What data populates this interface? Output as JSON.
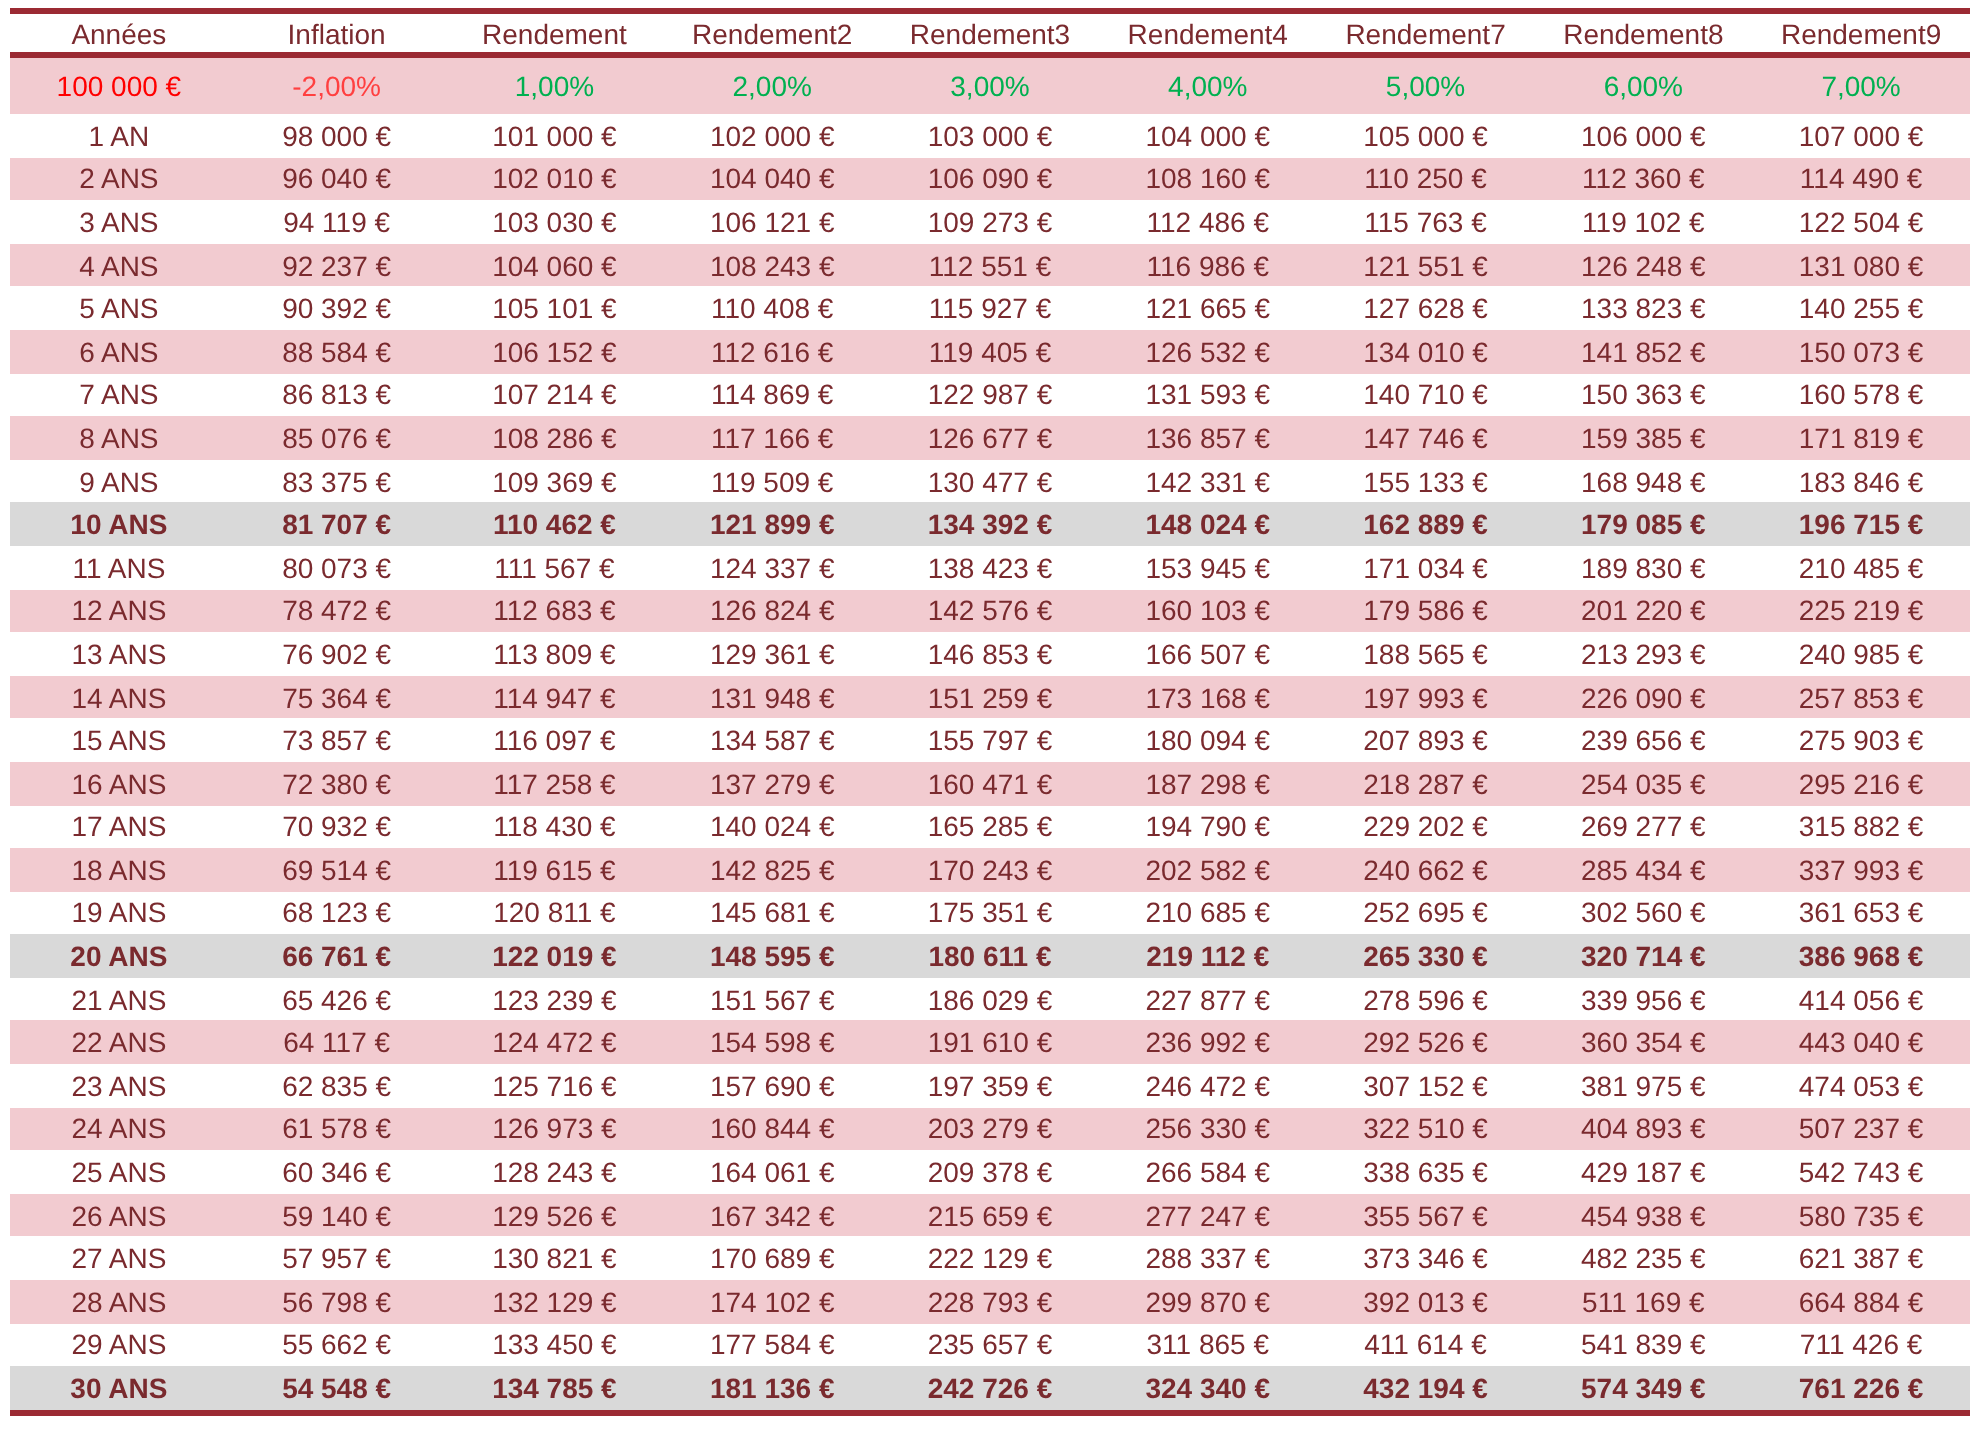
{
  "table": {
    "columns": [
      "Années",
      "Inflation",
      "Rendement",
      "Rendement2",
      "Rendement3",
      "Rendement4",
      "Rendement7",
      "Rendement8",
      "Rendement9"
    ],
    "rates": [
      {
        "text": "100 000 €",
        "color": "#ff0000"
      },
      {
        "text": "-2,00%",
        "color": "#ff4040"
      },
      {
        "text": "1,00%",
        "color": "#00b050"
      },
      {
        "text": "2,00%",
        "color": "#00b050"
      },
      {
        "text": "3,00%",
        "color": "#00b050"
      },
      {
        "text": "4,00%",
        "color": "#00b050"
      },
      {
        "text": "5,00%",
        "color": "#00b050"
      },
      {
        "text": "6,00%",
        "color": "#00b050"
      },
      {
        "text": "7,00%",
        "color": "#00b050"
      }
    ],
    "rows": [
      {
        "kind": "plain",
        "cells": [
          "1 AN",
          "98 000 €",
          "101 000 €",
          "102 000 €",
          "103 000 €",
          "104 000 €",
          "105 000 €",
          "106 000 €",
          "107 000 €"
        ]
      },
      {
        "kind": "striped",
        "cells": [
          "2 ANS",
          "96 040 €",
          "102 010 €",
          "104 040 €",
          "106 090 €",
          "108 160 €",
          "110 250 €",
          "112 360 €",
          "114 490 €"
        ]
      },
      {
        "kind": "plain",
        "cells": [
          "3 ANS",
          "94 119 €",
          "103 030 €",
          "106 121 €",
          "109 273 €",
          "112 486 €",
          "115 763 €",
          "119 102 €",
          "122 504 €"
        ]
      },
      {
        "kind": "striped",
        "cells": [
          "4 ANS",
          "92 237 €",
          "104 060 €",
          "108 243 €",
          "112 551 €",
          "116 986 €",
          "121 551 €",
          "126 248 €",
          "131 080 €"
        ]
      },
      {
        "kind": "plain",
        "cells": [
          "5 ANS",
          "90 392 €",
          "105 101 €",
          "110 408 €",
          "115 927 €",
          "121 665 €",
          "127 628 €",
          "133 823 €",
          "140 255 €"
        ]
      },
      {
        "kind": "striped",
        "cells": [
          "6 ANS",
          "88 584 €",
          "106 152 €",
          "112 616 €",
          "119 405 €",
          "126 532 €",
          "134 010 €",
          "141 852 €",
          "150 073 €"
        ]
      },
      {
        "kind": "plain",
        "cells": [
          "7 ANS",
          "86 813 €",
          "107 214 €",
          "114 869 €",
          "122 987 €",
          "131 593 €",
          "140 710 €",
          "150 363 €",
          "160 578 €"
        ]
      },
      {
        "kind": "striped",
        "cells": [
          "8 ANS",
          "85 076 €",
          "108 286 €",
          "117 166 €",
          "126 677 €",
          "136 857 €",
          "147 746 €",
          "159 385 €",
          "171 819 €"
        ]
      },
      {
        "kind": "plain",
        "cells": [
          "9 ANS",
          "83 375 €",
          "109 369 €",
          "119 509 €",
          "130 477 €",
          "142 331 €",
          "155 133 €",
          "168 948 €",
          "183 846 €"
        ]
      },
      {
        "kind": "milestone",
        "cells": [
          "10 ANS",
          "81 707 €",
          "110 462 €",
          "121 899 €",
          "134 392 €",
          "148 024 €",
          "162 889 €",
          "179 085 €",
          "196 715 €"
        ]
      },
      {
        "kind": "plain",
        "cells": [
          "11 ANS",
          "80 073 €",
          "111 567 €",
          "124 337 €",
          "138 423 €",
          "153 945 €",
          "171 034 €",
          "189 830 €",
          "210 485 €"
        ]
      },
      {
        "kind": "striped",
        "cells": [
          "12 ANS",
          "78 472 €",
          "112 683 €",
          "126 824 €",
          "142 576 €",
          "160 103 €",
          "179 586 €",
          "201 220 €",
          "225 219 €"
        ]
      },
      {
        "kind": "plain",
        "cells": [
          "13 ANS",
          "76 902 €",
          "113 809 €",
          "129 361 €",
          "146 853 €",
          "166 507 €",
          "188 565 €",
          "213 293 €",
          "240 985 €"
        ]
      },
      {
        "kind": "striped",
        "cells": [
          "14 ANS",
          "75 364 €",
          "114 947 €",
          "131 948 €",
          "151 259 €",
          "173 168 €",
          "197 993 €",
          "226 090 €",
          "257 853 €"
        ]
      },
      {
        "kind": "plain",
        "cells": [
          "15 ANS",
          "73 857 €",
          "116 097 €",
          "134 587 €",
          "155 797 €",
          "180 094 €",
          "207 893 €",
          "239 656 €",
          "275 903 €"
        ]
      },
      {
        "kind": "striped",
        "cells": [
          "16 ANS",
          "72 380 €",
          "117 258 €",
          "137 279 €",
          "160 471 €",
          "187 298 €",
          "218 287 €",
          "254 035 €",
          "295 216 €"
        ]
      },
      {
        "kind": "plain",
        "cells": [
          "17 ANS",
          "70 932 €",
          "118 430 €",
          "140 024 €",
          "165 285 €",
          "194 790 €",
          "229 202 €",
          "269 277 €",
          "315 882 €"
        ]
      },
      {
        "kind": "striped",
        "cells": [
          "18 ANS",
          "69 514 €",
          "119 615 €",
          "142 825 €",
          "170 243 €",
          "202 582 €",
          "240 662 €",
          "285 434 €",
          "337 993 €"
        ]
      },
      {
        "kind": "plain",
        "cells": [
          "19 ANS",
          "68 123 €",
          "120 811 €",
          "145 681 €",
          "175 351 €",
          "210 685 €",
          "252 695 €",
          "302 560 €",
          "361 653 €"
        ]
      },
      {
        "kind": "milestone",
        "cells": [
          "20 ANS",
          "66 761 €",
          "122 019 €",
          "148 595 €",
          "180 611 €",
          "219 112 €",
          "265 330 €",
          "320 714 €",
          "386 968 €"
        ]
      },
      {
        "kind": "plain",
        "cells": [
          "21 ANS",
          "65 426 €",
          "123 239 €",
          "151 567 €",
          "186 029 €",
          "227 877 €",
          "278 596 €",
          "339 956 €",
          "414 056 €"
        ]
      },
      {
        "kind": "striped",
        "cells": [
          "22 ANS",
          "64 117 €",
          "124 472 €",
          "154 598 €",
          "191 610 €",
          "236 992 €",
          "292 526 €",
          "360 354 €",
          "443 040 €"
        ]
      },
      {
        "kind": "plain",
        "cells": [
          "23 ANS",
          "62 835 €",
          "125 716 €",
          "157 690 €",
          "197 359 €",
          "246 472 €",
          "307 152 €",
          "381 975 €",
          "474 053 €"
        ]
      },
      {
        "kind": "striped",
        "cells": [
          "24 ANS",
          "61 578 €",
          "126 973 €",
          "160 844 €",
          "203 279 €",
          "256 330 €",
          "322 510 €",
          "404 893 €",
          "507 237 €"
        ]
      },
      {
        "kind": "plain",
        "cells": [
          "25 ANS",
          "60 346 €",
          "128 243 €",
          "164 061 €",
          "209 378 €",
          "266 584 €",
          "338 635 €",
          "429 187 €",
          "542 743 €"
        ]
      },
      {
        "kind": "striped",
        "cells": [
          "26 ANS",
          "59 140 €",
          "129 526 €",
          "167 342 €",
          "215 659 €",
          "277 247 €",
          "355 567 €",
          "454 938 €",
          "580 735 €"
        ]
      },
      {
        "kind": "plain",
        "cells": [
          "27 ANS",
          "57 957 €",
          "130 821 €",
          "170 689 €",
          "222 129 €",
          "288 337 €",
          "373 346 €",
          "482 235 €",
          "621 387 €"
        ]
      },
      {
        "kind": "striped",
        "cells": [
          "28 ANS",
          "56 798 €",
          "132 129 €",
          "174 102 €",
          "228 793 €",
          "299 870 €",
          "392 013 €",
          "511 169 €",
          "664 884 €"
        ]
      },
      {
        "kind": "plain",
        "cells": [
          "29 ANS",
          "55 662 €",
          "133 450 €",
          "177 584 €",
          "235 657 €",
          "311 865 €",
          "411 614 €",
          "541 839 €",
          "711 426 €"
        ]
      },
      {
        "kind": "milestone",
        "cells": [
          "30 ANS",
          "54 548 €",
          "134 785 €",
          "181 136 €",
          "242 726 €",
          "324 340 €",
          "432 194 €",
          "574 349 €",
          "761 226 €"
        ]
      }
    ]
  }
}
